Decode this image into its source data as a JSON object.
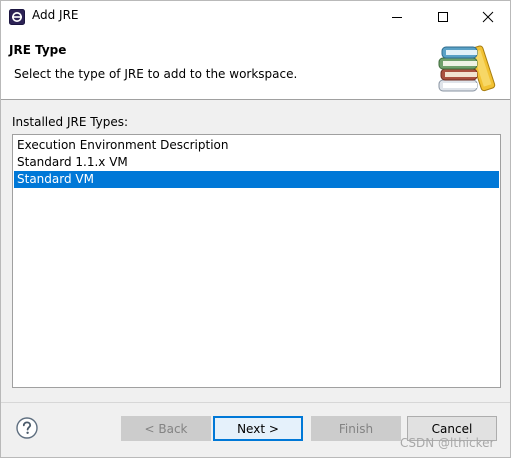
{
  "window": {
    "title": "Add JRE",
    "icon": "eclipse-icon",
    "controls": [
      "minimize-icon",
      "maximize-icon",
      "close-icon"
    ]
  },
  "banner": {
    "title": "JRE Type",
    "description": "Select the type of JRE to add to the workspace.",
    "image": "books-stack-icon"
  },
  "content": {
    "label": "Installed JRE Types:",
    "items": [
      {
        "label": "Execution Environment Description",
        "selected": false
      },
      {
        "label": "Standard 1.1.x VM",
        "selected": false
      },
      {
        "label": "Standard VM",
        "selected": true
      }
    ],
    "selection_color": "#0078d7"
  },
  "footer": {
    "help_icon": "help-icon",
    "back_label": "< Back",
    "next_label": "Next >",
    "finish_label": "Finish",
    "cancel_label": "Cancel"
  },
  "watermark": "CSDN @lthicker"
}
